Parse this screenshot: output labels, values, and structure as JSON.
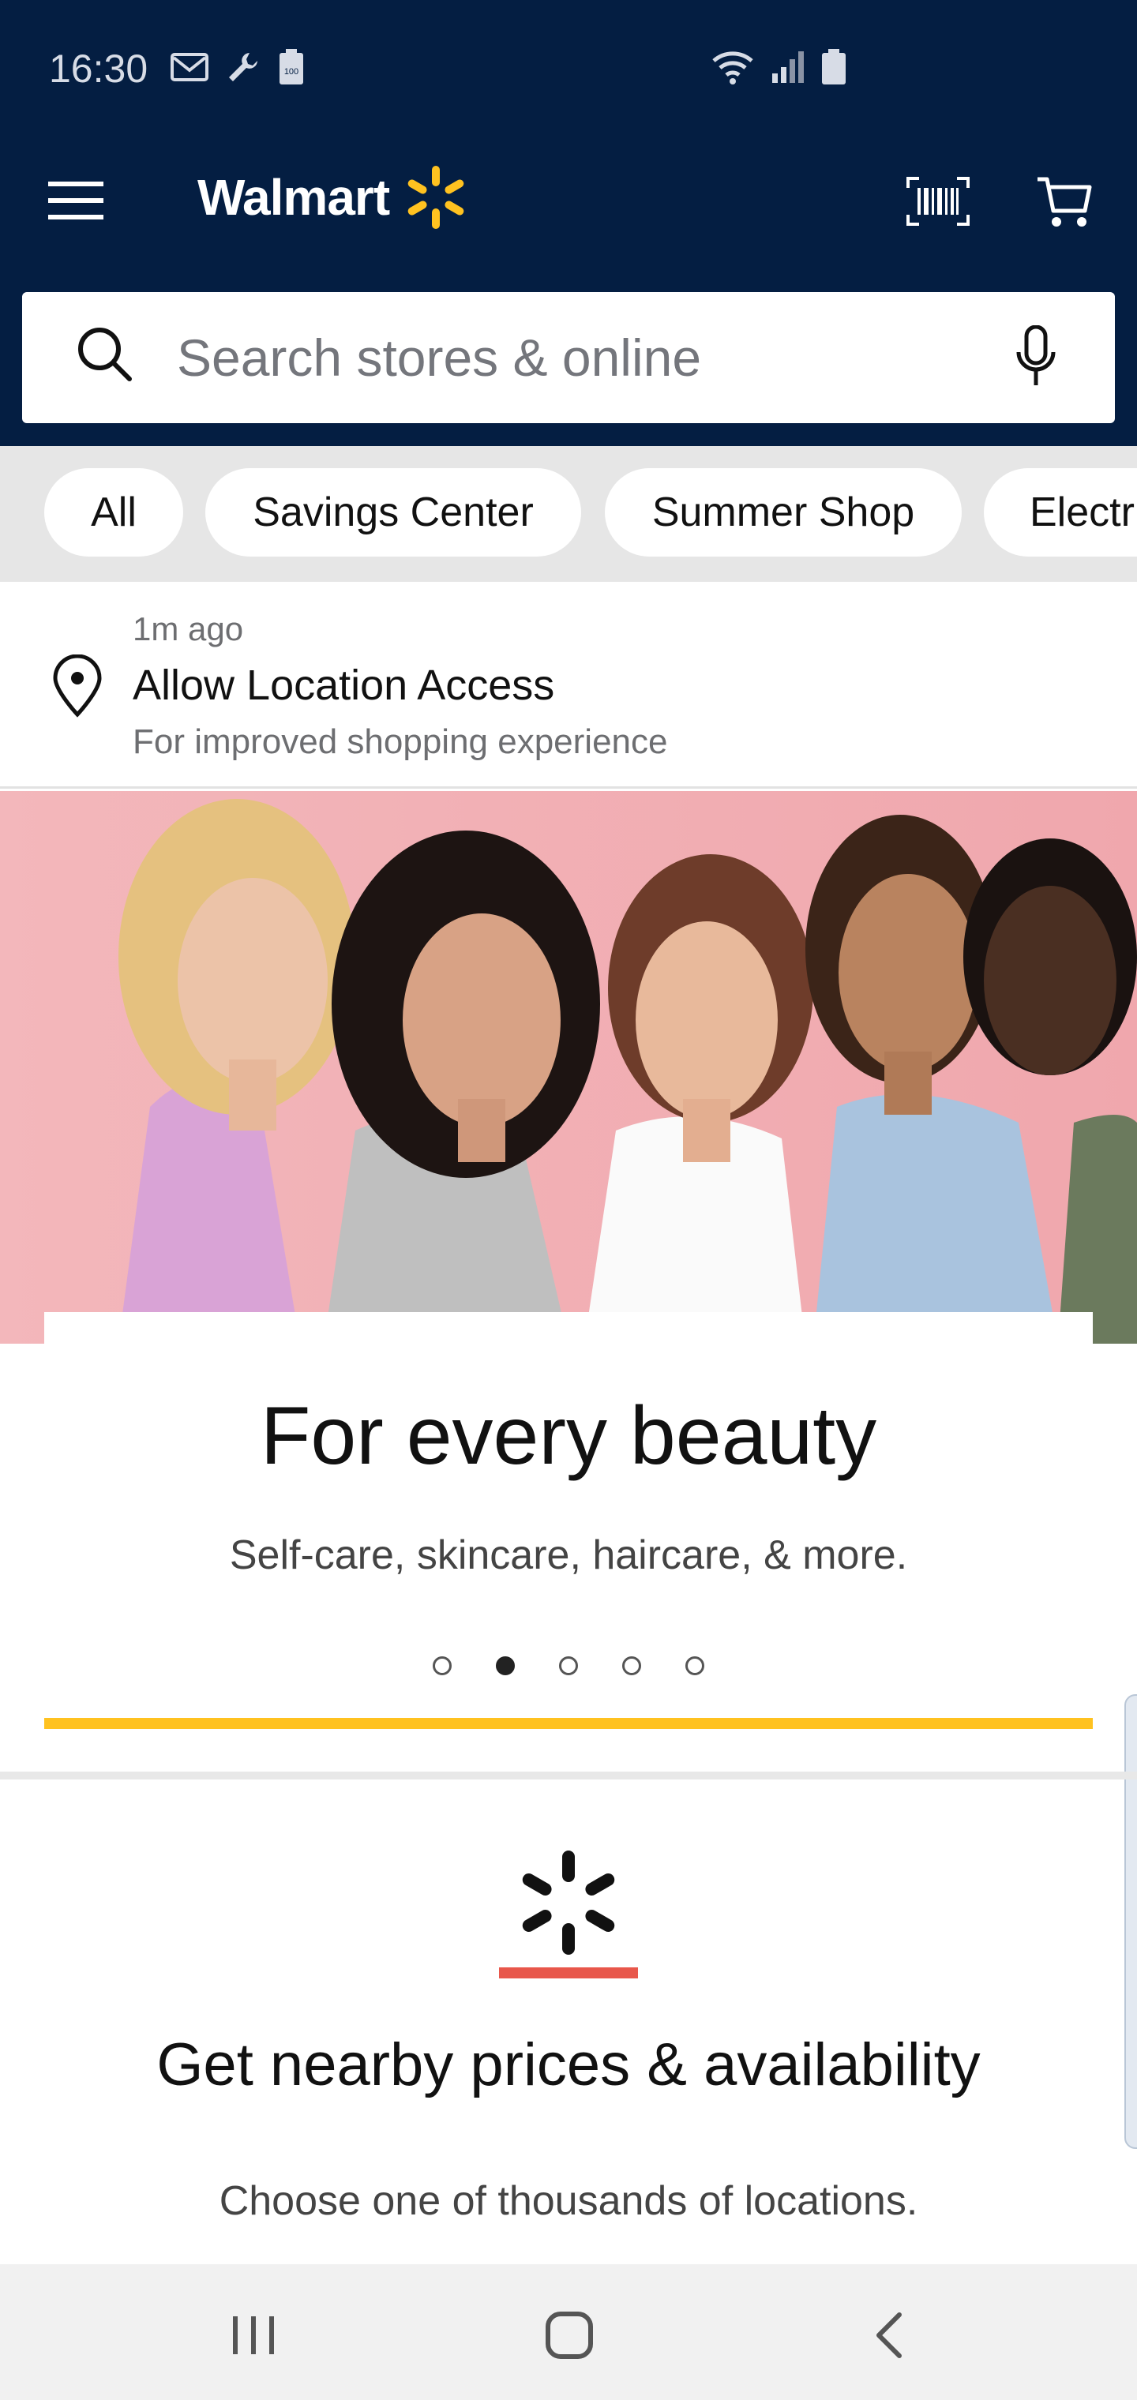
{
  "status_bar": {
    "time": "16:30",
    "left_icons": [
      "gmail-icon",
      "wrench-icon",
      "battery-saver-icon"
    ],
    "right_icons": [
      "wifi-icon",
      "signal-icon",
      "battery-icon"
    ]
  },
  "app_bar": {
    "logo_text": "Walmart",
    "menu_icon": "hamburger-menu-icon",
    "barcode_icon": "barcode-scanner-icon",
    "cart_icon": "cart-icon",
    "brand_color": "#041e42",
    "spark_color": "#ffc220"
  },
  "search": {
    "placeholder": "Search stores & online",
    "value": ""
  },
  "chips": [
    {
      "label": "All"
    },
    {
      "label": "Savings Center"
    },
    {
      "label": "Summer Shop"
    },
    {
      "label": "Electr"
    }
  ],
  "notification": {
    "time": "1m ago",
    "title": "Allow Location Access",
    "subtitle": "For improved shopping experience"
  },
  "hero": {
    "title": "For every beauty",
    "subtitle": "Self-care, skincare, haircare, & more.",
    "slide_count": 5,
    "active_slide": 2,
    "accent_color": "#ffc220"
  },
  "location_section": {
    "title": "Get nearby prices & availability",
    "subtitle": "Choose one of thousands of locations.",
    "accent_color": "#e8574b"
  },
  "nav_bar": {
    "icons": [
      "recent-apps-icon",
      "home-icon",
      "back-icon"
    ]
  }
}
